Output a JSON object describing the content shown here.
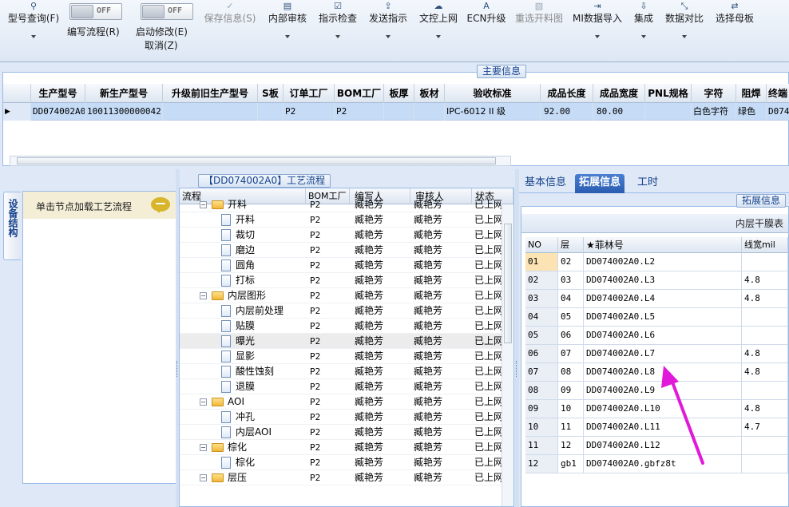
{
  "toolbar": {
    "query": "型号查询(F)",
    "toggle1_off": "OFF",
    "toggle1_label": "编写流程(R)",
    "toggle2_off": "OFF",
    "toggle2_label": "启动修改(E)",
    "cancel": "取消(Z)",
    "save": "保存信息(S)",
    "internal_audit": "内部审核",
    "instruction_check": "指示检查",
    "send_instruction": "发送指示",
    "doc_online": "文控上网",
    "ecn_upgrade": "ECN升级",
    "reselect_chart": "重选开料图",
    "mi_import": "MI数据导入",
    "integrate": "集成",
    "compare": "数据对比",
    "select_mother": "选择母板"
  },
  "main_panel": {
    "title": "主要信息",
    "columns": [
      "生产型号",
      "新生产型号",
      "升级前旧生产型号",
      "S板",
      "订单工厂",
      "BOM工厂",
      "板厚",
      "板材",
      "验收标准",
      "成品长度",
      "成品宽度",
      "PNL规格",
      "字符",
      "阻焊",
      "终端"
    ],
    "row": {
      "marker": "▶",
      "cells": [
        "DD074002A0",
        "10011300000042",
        "",
        "",
        "P2",
        "P2",
        "",
        "",
        "IPC-6012 II 级",
        "92.00",
        "80.00",
        "",
        "白色字符",
        "绿色",
        "D074"
      ]
    }
  },
  "device_panel": {
    "side_tab": "设备结构",
    "hint": "单击节点加载工艺流程"
  },
  "flow_panel": {
    "title": "【DD074002A0】工艺流程",
    "columns": [
      "流程",
      "BOM工厂",
      "编写人",
      "审核人",
      "状态"
    ],
    "rows": [
      {
        "name": "开料",
        "type": "folder",
        "factory": "P2",
        "author": "臧艳芳",
        "reviewer": "臧艳芳",
        "status": "已上网"
      },
      {
        "name": "开料",
        "type": "doc",
        "factory": "P2",
        "author": "臧艳芳",
        "reviewer": "臧艳芳",
        "status": "已上网"
      },
      {
        "name": "裁切",
        "type": "doc",
        "factory": "P2",
        "author": "臧艳芳",
        "reviewer": "臧艳芳",
        "status": "已上网"
      },
      {
        "name": "磨边",
        "type": "doc",
        "factory": "P2",
        "author": "臧艳芳",
        "reviewer": "臧艳芳",
        "status": "已上网"
      },
      {
        "name": "圆角",
        "type": "doc",
        "factory": "P2",
        "author": "臧艳芳",
        "reviewer": "臧艳芳",
        "status": "已上网"
      },
      {
        "name": "打标",
        "type": "doc",
        "factory": "P2",
        "author": "臧艳芳",
        "reviewer": "臧艳芳",
        "status": "已上网"
      },
      {
        "name": "内层图形",
        "type": "folder",
        "factory": "P2",
        "author": "臧艳芳",
        "reviewer": "臧艳芳",
        "status": "已上网"
      },
      {
        "name": "内层前处理",
        "type": "doc",
        "factory": "P2",
        "author": "臧艳芳",
        "reviewer": "臧艳芳",
        "status": "已上网"
      },
      {
        "name": "贴膜",
        "type": "doc",
        "factory": "P2",
        "author": "臧艳芳",
        "reviewer": "臧艳芳",
        "status": "已上网"
      },
      {
        "name": "曝光",
        "type": "doc",
        "factory": "P2",
        "author": "臧艳芳",
        "reviewer": "臧艳芳",
        "status": "已上网",
        "selected": true
      },
      {
        "name": "显影",
        "type": "doc",
        "factory": "P2",
        "author": "臧艳芳",
        "reviewer": "臧艳芳",
        "status": "已上网"
      },
      {
        "name": "酸性蚀刻",
        "type": "doc",
        "factory": "P2",
        "author": "臧艳芳",
        "reviewer": "臧艳芳",
        "status": "已上网"
      },
      {
        "name": "退膜",
        "type": "doc",
        "factory": "P2",
        "author": "臧艳芳",
        "reviewer": "臧艳芳",
        "status": "已上网"
      },
      {
        "name": "AOI",
        "type": "folder",
        "factory": "P2",
        "author": "臧艳芳",
        "reviewer": "臧艳芳",
        "status": "已上网"
      },
      {
        "name": "冲孔",
        "type": "doc",
        "factory": "P2",
        "author": "臧艳芳",
        "reviewer": "臧艳芳",
        "status": "已上网"
      },
      {
        "name": "内层AOI",
        "type": "doc",
        "factory": "P2",
        "author": "臧艳芳",
        "reviewer": "臧艳芳",
        "status": "已上网"
      },
      {
        "name": "棕化",
        "type": "folder",
        "factory": "P2",
        "author": "臧艳芳",
        "reviewer": "臧艳芳",
        "status": "已上网"
      },
      {
        "name": "棕化",
        "type": "doc",
        "factory": "P2",
        "author": "臧艳芳",
        "reviewer": "臧艳芳",
        "status": "已上网"
      },
      {
        "name": "层压",
        "type": "folder",
        "factory": "P2",
        "author": "臧艳芳",
        "reviewer": "臧艳芳",
        "status": "已上网"
      }
    ]
  },
  "right_panel": {
    "tabs": [
      "基本信息",
      "拓展信息",
      "工时"
    ],
    "active_tab": "拓展信息",
    "title": "拓展信息",
    "subtitle": "内层干膜表",
    "columns": [
      "NO",
      "层",
      "★菲林号",
      "线宽mil"
    ],
    "rows": [
      {
        "no": "01",
        "layer": "02",
        "film": "DD074002A0.L2",
        "width": ""
      },
      {
        "no": "02",
        "layer": "03",
        "film": "DD074002A0.L3",
        "width": "4.8"
      },
      {
        "no": "03",
        "layer": "04",
        "film": "DD074002A0.L4",
        "width": "4.8"
      },
      {
        "no": "04",
        "layer": "05",
        "film": "DD074002A0.L5",
        "width": ""
      },
      {
        "no": "05",
        "layer": "06",
        "film": "DD074002A0.L6",
        "width": ""
      },
      {
        "no": "06",
        "layer": "07",
        "film": "DD074002A0.L7",
        "width": "4.8"
      },
      {
        "no": "07",
        "layer": "08",
        "film": "DD074002A0.L8",
        "width": "4.8"
      },
      {
        "no": "08",
        "layer": "09",
        "film": "DD074002A0.L9",
        "width": ""
      },
      {
        "no": "09",
        "layer": "10",
        "film": "DD074002A0.L10",
        "width": "4.8"
      },
      {
        "no": "10",
        "layer": "11",
        "film": "DD074002A0.L11",
        "width": "4.7"
      },
      {
        "no": "11",
        "layer": "12",
        "film": "DD074002A0.L12",
        "width": ""
      },
      {
        "no": "12",
        "layer": "gb1",
        "film": "DD074002A0.gbfz8t",
        "width": ""
      }
    ]
  },
  "colors": {
    "accent": "#15428b",
    "annotation_arrow": "#e01ad8",
    "selected_row": "#c5dbf6"
  }
}
